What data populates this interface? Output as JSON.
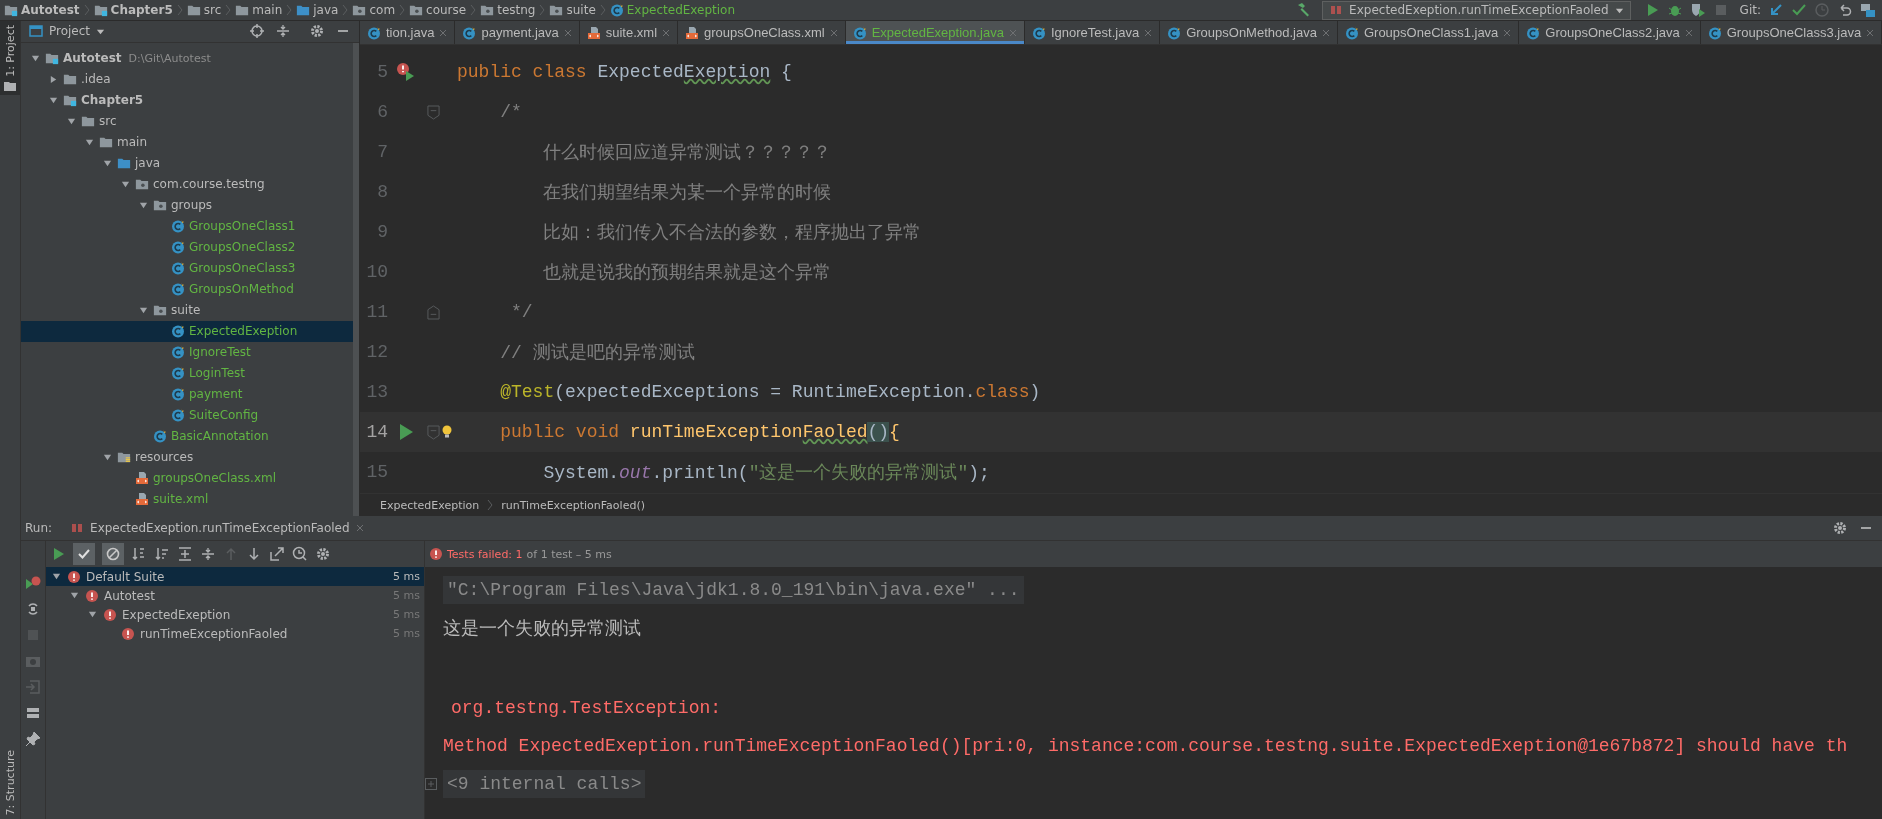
{
  "nav_bar": {
    "crumbs": [
      {
        "label": "Autotest",
        "kind": "module"
      },
      {
        "label": "Chapter5",
        "kind": "module"
      },
      {
        "label": "src",
        "kind": "folder"
      },
      {
        "label": "main",
        "kind": "folder"
      },
      {
        "label": "java",
        "kind": "source-folder"
      },
      {
        "label": "com",
        "kind": "package"
      },
      {
        "label": "course",
        "kind": "package"
      },
      {
        "label": "testng",
        "kind": "package"
      },
      {
        "label": "suite",
        "kind": "package"
      },
      {
        "label": "ExpectedExeption",
        "kind": "class"
      }
    ],
    "run_config": "ExpectedExeption.runTimeExceptionFaoled",
    "vcs_label": "Git:"
  },
  "side_strip": {
    "top_tab": "1: Project",
    "bottom_tab": "7: Structure"
  },
  "project_panel": {
    "title": "Project",
    "tree": [
      {
        "label": "Autotest",
        "path": "D:\\Git\\Autotest",
        "kind": "module",
        "expanded": true,
        "selected": false,
        "children": [
          {
            "label": ".idea",
            "kind": "folder",
            "expanded": false,
            "selected": false
          },
          {
            "label": "Chapter5",
            "kind": "module",
            "expanded": true,
            "selected": false,
            "children": [
              {
                "label": "src",
                "kind": "folder",
                "expanded": true,
                "selected": false,
                "children": [
                  {
                    "label": "main",
                    "kind": "folder",
                    "expanded": true,
                    "selected": false,
                    "children": [
                      {
                        "label": "java",
                        "kind": "source-folder",
                        "expanded": true,
                        "selected": false,
                        "children": [
                          {
                            "label": "com.course.testng",
                            "kind": "package",
                            "expanded": true,
                            "selected": false,
                            "children": [
                              {
                                "label": "groups",
                                "kind": "package",
                                "expanded": true,
                                "selected": false,
                                "children": [
                                  {
                                    "label": "GroupsOneClass1",
                                    "kind": "class",
                                    "selected": false
                                  },
                                  {
                                    "label": "GroupsOneClass2",
                                    "kind": "class",
                                    "selected": false
                                  },
                                  {
                                    "label": "GroupsOneClass3",
                                    "kind": "class",
                                    "selected": false
                                  },
                                  {
                                    "label": "GroupsOnMethod",
                                    "kind": "class",
                                    "selected": false
                                  }
                                ]
                              },
                              {
                                "label": "suite",
                                "kind": "package",
                                "expanded": true,
                                "selected": false,
                                "children": [
                                  {
                                    "label": "ExpectedExeption",
                                    "kind": "class",
                                    "selected": true
                                  },
                                  {
                                    "label": "IgnoreTest",
                                    "kind": "class",
                                    "selected": false
                                  },
                                  {
                                    "label": "LoginTest",
                                    "kind": "class",
                                    "selected": false
                                  },
                                  {
                                    "label": "payment",
                                    "kind": "class",
                                    "selected": false
                                  },
                                  {
                                    "label": "SuiteConfig",
                                    "kind": "class",
                                    "selected": false
                                  }
                                ]
                              },
                              {
                                "label": "BasicAnnotation",
                                "kind": "class",
                                "selected": false
                              }
                            ]
                          }
                        ]
                      },
                      {
                        "label": "resources",
                        "kind": "resource-folder",
                        "expanded": true,
                        "selected": false,
                        "children": [
                          {
                            "label": "groupsOneClass.xml",
                            "kind": "xml",
                            "selected": false
                          },
                          {
                            "label": "suite.xml",
                            "kind": "xml",
                            "selected": false
                          }
                        ]
                      }
                    ]
                  }
                ]
              }
            ]
          }
        ]
      }
    ]
  },
  "editor": {
    "tabs": [
      {
        "label": "tion.java",
        "kind": "class",
        "selected": false
      },
      {
        "label": "payment.java",
        "kind": "class",
        "selected": false
      },
      {
        "label": "suite.xml",
        "kind": "xml",
        "selected": false
      },
      {
        "label": "groupsOneClass.xml",
        "kind": "xml",
        "selected": false
      },
      {
        "label": "ExpectedExeption.java",
        "kind": "class",
        "selected": true
      },
      {
        "label": "IgnoreTest.java",
        "kind": "class",
        "selected": false
      },
      {
        "label": "GroupsOnMethod.java",
        "kind": "class",
        "selected": false
      },
      {
        "label": "GroupsOneClass1.java",
        "kind": "class",
        "selected": false
      },
      {
        "label": "GroupsOneClass2.java",
        "kind": "class",
        "selected": false
      },
      {
        "label": "GroupsOneClass3.java",
        "kind": "class",
        "selected": false
      }
    ],
    "lines": [
      {
        "number": "5",
        "error_mark": true,
        "run_button": true,
        "current": false,
        "tokens": [
          {
            "kind": "keyword",
            "text": "public class "
          },
          {
            "kind": "plain",
            "text": "Expected"
          },
          {
            "kind": "plain",
            "text": "Exeption",
            "typo": true
          },
          {
            "kind": "plain",
            "text": " {"
          }
        ]
      },
      {
        "number": "6",
        "fold_start": true,
        "current": false,
        "tokens": [
          {
            "kind": "comment",
            "text": "    /*"
          }
        ]
      },
      {
        "number": "7",
        "current": false,
        "tokens": [
          {
            "kind": "comment",
            "text": "        什么时候回应道异常测试？？？？？"
          }
        ]
      },
      {
        "number": "8",
        "current": false,
        "tokens": [
          {
            "kind": "comment",
            "text": "        在我们期望结果为某一个异常的时候"
          }
        ]
      },
      {
        "number": "9",
        "current": false,
        "tokens": [
          {
            "kind": "comment",
            "text": "        比如：我们传入不合法的参数，程序抛出了异常"
          }
        ]
      },
      {
        "number": "10",
        "current": false,
        "tokens": [
          {
            "kind": "comment",
            "text": "        也就是说我的预期结果就是这个异常"
          }
        ]
      },
      {
        "number": "11",
        "fold_end": true,
        "current": false,
        "tokens": [
          {
            "kind": "comment",
            "text": "     */"
          }
        ]
      },
      {
        "number": "12",
        "current": false,
        "tokens": [
          {
            "kind": "comment",
            "text": "    // 测试是吧的异常测试"
          }
        ]
      },
      {
        "number": "13",
        "current": false,
        "tokens": [
          {
            "kind": "annotation",
            "text": "    @Test"
          },
          {
            "kind": "plain",
            "text": "(expectedExceptions = RuntimeException."
          },
          {
            "kind": "keyword",
            "text": "class"
          },
          {
            "kind": "plain",
            "text": ")"
          }
        ]
      },
      {
        "number": "14",
        "run_button": true,
        "fold_start": true,
        "bulb": true,
        "current": true,
        "tokens": [
          {
            "kind": "keyword",
            "text": "    public void "
          },
          {
            "kind": "method",
            "text": "runTimeException"
          },
          {
            "kind": "method",
            "text": "Faoled",
            "typo": true
          },
          {
            "kind": "plain",
            "text": "()",
            "matched": true
          },
          {
            "kind": "method",
            "text": "{"
          }
        ]
      },
      {
        "number": "15",
        "current": false,
        "tokens": [
          {
            "kind": "plain",
            "text": "        System."
          },
          {
            "kind": "field",
            "text": "out"
          },
          {
            "kind": "plain",
            "text": ".println("
          },
          {
            "kind": "string",
            "text": "\"这是一个失败的异常测试\""
          },
          {
            "kind": "plain",
            "text": ");"
          }
        ]
      }
    ],
    "breadcrumbs": [
      "ExpectedExeption",
      "runTimeExceptionFaoled()"
    ]
  },
  "run_panel": {
    "label": "Run:",
    "tab": "ExpectedExeption.runTimeExceptionFaoled",
    "show_passed": true,
    "show_ignored": true,
    "status": {
      "failed": "Tests failed: 1",
      "detail": "of 1 test – 5 ms"
    },
    "tree": [
      {
        "label": "Default Suite",
        "time": "5 ms",
        "failed": true,
        "expanded": true,
        "selected": true,
        "children": [
          {
            "label": "Autotest",
            "time": "5 ms",
            "failed": true,
            "expanded": true,
            "selected": false,
            "children": [
              {
                "label": "ExpectedExeption",
                "time": "5 ms",
                "failed": true,
                "expanded": true,
                "selected": false,
                "children": [
                  {
                    "label": "runTimeExceptionFaoled",
                    "time": "5 ms",
                    "failed": true,
                    "selected": false
                  }
                ]
              }
            ]
          }
        ]
      }
    ],
    "console": [
      {
        "kind": "command",
        "text": "\"C:\\Program Files\\Java\\jdk1.8.0_191\\bin\\java.exe\" ..."
      },
      {
        "kind": "output",
        "text": "这是一个失败的异常测试"
      },
      {
        "kind": "error",
        "text": "org.testng.TestException:"
      },
      {
        "kind": "error",
        "text": "Method ExpectedExeption.runTimeExceptionFaoled()[pri:0, instance:com.course.testng.suite.ExpectedExeption@1e67b872] should have th"
      },
      {
        "kind": "collapsed",
        "text": "<9 internal calls>"
      }
    ]
  }
}
